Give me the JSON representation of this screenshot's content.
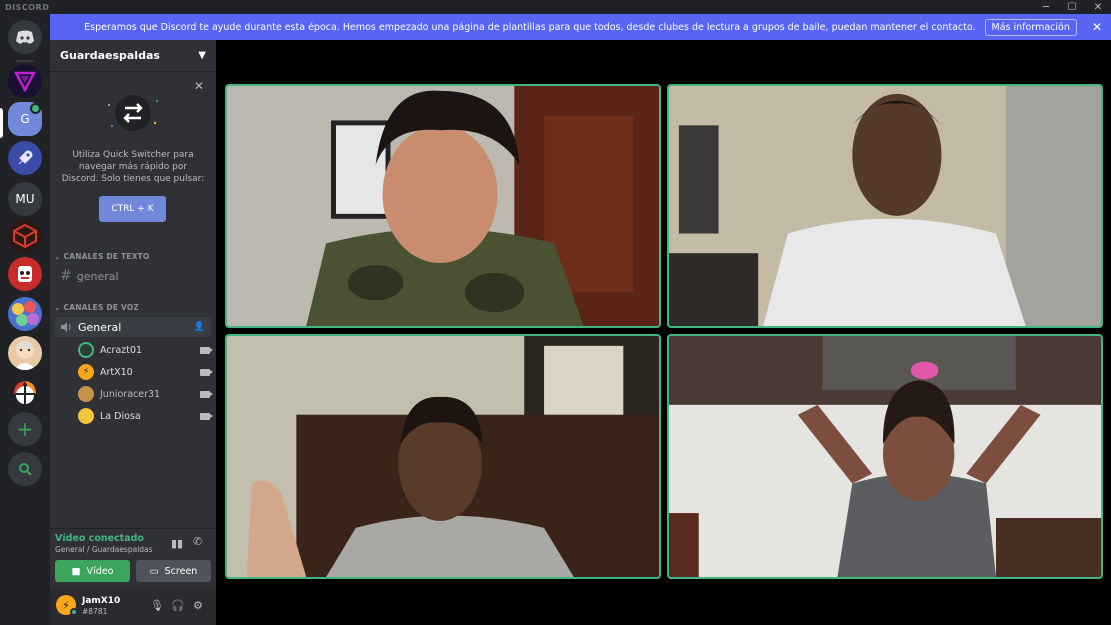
{
  "titlebar": {
    "brand": "DISCORD",
    "minimize": "─",
    "maximize": "☐",
    "close": "✕"
  },
  "notice": {
    "text": "Esperamos que Discord te ayude durante esta época. Hemos empezado una página de plantillas para que todos, desde clubes de lectura a grupos de baile, puedan mantener el contacto.",
    "button": "Más información",
    "close": "✕"
  },
  "guilds": {
    "home_icon": "discord-logo-icon",
    "servers": [
      {
        "name": "server-v",
        "label": ""
      },
      {
        "name": "server-guardaespaldas",
        "label": "G"
      },
      {
        "name": "server-rocket",
        "label": ""
      },
      {
        "name": "server-mu",
        "label": "MU"
      },
      {
        "name": "server-red-box",
        "label": ""
      },
      {
        "name": "server-red-character",
        "label": ""
      },
      {
        "name": "server-colorful",
        "label": ""
      },
      {
        "name": "server-face",
        "label": ""
      },
      {
        "name": "server-smash",
        "label": ""
      }
    ],
    "add_label": "+",
    "explore_icon": "search-icon"
  },
  "server": {
    "name": "Guardaespaldas"
  },
  "quick_switcher": {
    "text": "Utiliza Quick Switcher para navegar más rápido por Discord. Solo tienes que pulsar:",
    "shortcut": "CTRL + K"
  },
  "channels": {
    "text_category": "CANALES DE TEXTO",
    "text_channels": [
      {
        "name": "general"
      }
    ],
    "voice_category": "CANALES DE VOZ",
    "voice_channel": "General",
    "voice_users": [
      {
        "name": "Acrazt01",
        "color": "#2c3e33"
      },
      {
        "name": "ArtX10",
        "color": "#faa61a"
      },
      {
        "name": "Junioracer31",
        "color": "#c9924b"
      },
      {
        "name": "La Diosa",
        "color": "#f3c53a"
      }
    ]
  },
  "rtc": {
    "status": "Vídeo conectado",
    "location": "General / Guardaespaldas",
    "video_label": "Vídeo",
    "screen_label": "Screen"
  },
  "user": {
    "name": "JamX10",
    "tag": "#8781",
    "avatar_glyph": "⚡"
  },
  "colors": {
    "blurple": "#5865f2",
    "green": "#43b581",
    "bg": "#202225",
    "sidebar": "#2f3136"
  }
}
